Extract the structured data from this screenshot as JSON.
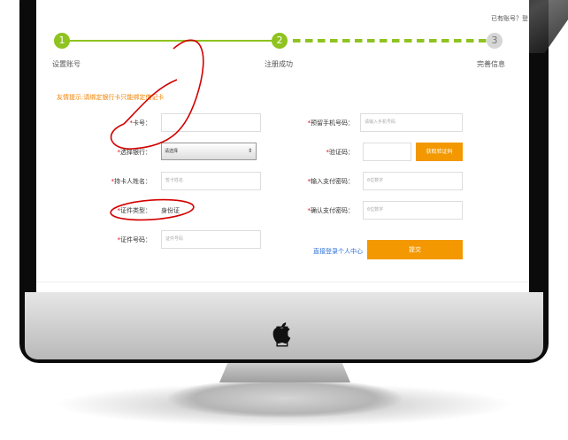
{
  "header": {
    "account_text": "已有账号？登"
  },
  "steps": [
    {
      "number": "1",
      "label": "设置账号"
    },
    {
      "number": "2",
      "label": "注册成功"
    },
    {
      "number": "3",
      "label": "完善信息"
    }
  ],
  "hint": "友情提示:请绑定银行卡只能绑定借记卡",
  "form": {
    "card_no": {
      "label": "卡号：",
      "value": ""
    },
    "bank": {
      "label": "选择银行：",
      "selected": "请选择"
    },
    "holder": {
      "label": "持卡人姓名：",
      "placeholder": "暂卡姓名"
    },
    "id_type": {
      "label": "证件类型：",
      "value": "身份证"
    },
    "id_no": {
      "label": "证件号码：",
      "placeholder": "证件号码"
    },
    "phone": {
      "label": "预留手机号码：",
      "placeholder": "请输入手机号码"
    },
    "code": {
      "label": "验证码：",
      "button": "获取验证码"
    },
    "pay_pwd": {
      "label": "输入支付密码：",
      "placeholder": "6位数字"
    },
    "confirm_pwd": {
      "label": "确认支付密码：",
      "placeholder": "6位数字"
    }
  },
  "actions": {
    "skip_link": "直接登录个人中心",
    "submit": "提交"
  },
  "colors": {
    "accent_green": "#8fc31f",
    "accent_orange": "#f39800",
    "annotation_red": "#d40000"
  },
  "icons": {
    "brand": "apple-logo-icon",
    "select": "select-arrows-icon"
  }
}
